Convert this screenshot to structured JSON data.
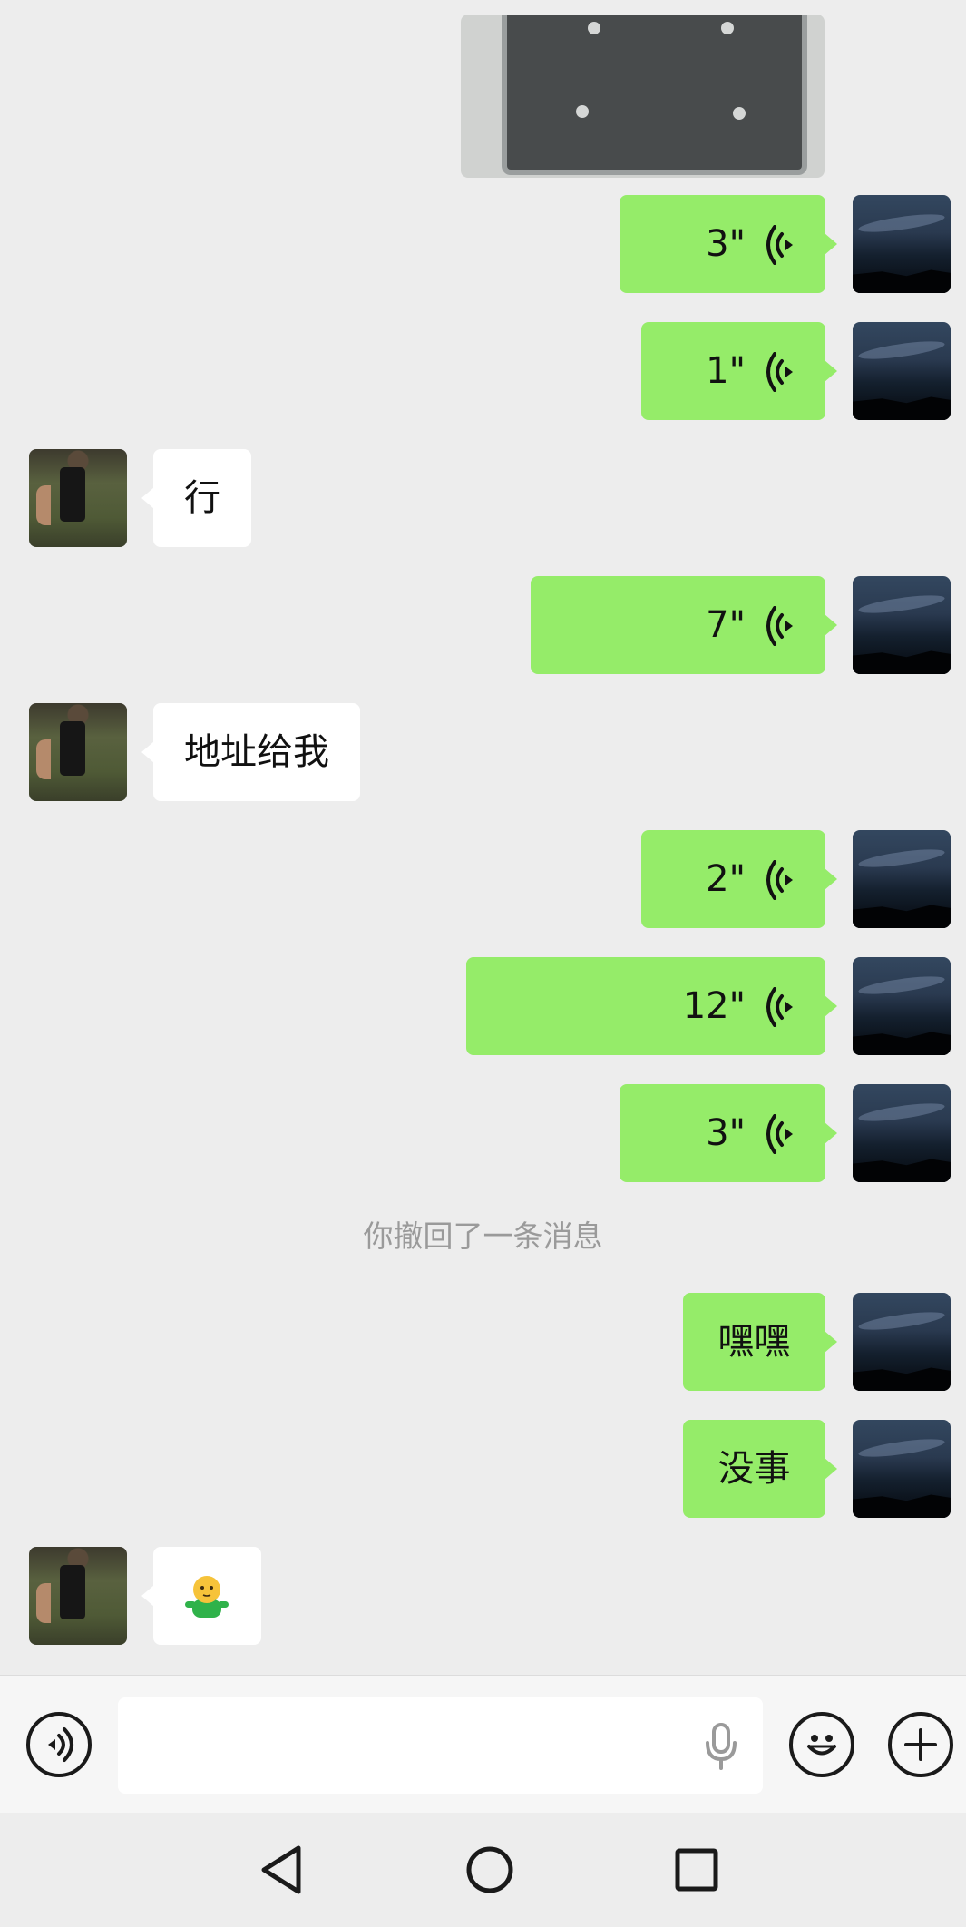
{
  "colors": {
    "background": "#ededed",
    "sent_bubble": "#95ec69",
    "received_bubble": "#ffffff",
    "system_text": "#9a9a9a",
    "input_bar": "#f6f6f6"
  },
  "messages": [
    {
      "type": "image",
      "side": "me"
    },
    {
      "type": "voice",
      "side": "me",
      "duration": "3\""
    },
    {
      "type": "voice",
      "side": "me",
      "duration": "1\""
    },
    {
      "type": "text",
      "side": "them",
      "text": "行"
    },
    {
      "type": "voice",
      "side": "me",
      "duration": "7\""
    },
    {
      "type": "text",
      "side": "them",
      "text": "地址给我"
    },
    {
      "type": "voice",
      "side": "me",
      "duration": "2\""
    },
    {
      "type": "voice",
      "side": "me",
      "duration": "12\""
    },
    {
      "type": "voice",
      "side": "me",
      "duration": "3\""
    },
    {
      "type": "system",
      "text": "你撤回了一条消息"
    },
    {
      "type": "text",
      "side": "me",
      "text": "嘿嘿"
    },
    {
      "type": "text",
      "side": "me",
      "text": "没事"
    },
    {
      "type": "text",
      "side": "them",
      "text": "🫠",
      "icon": "sticker-emoji"
    }
  ],
  "input_bar": {
    "voice_toggle_icon": "voice-mode-icon",
    "text_value": "",
    "mic_icon": "microphone-icon",
    "emoji_icon": "emoji-icon",
    "more_icon": "plus-icon"
  },
  "nav_bar": {
    "back_icon": "back-triangle-icon",
    "home_icon": "home-circle-icon",
    "recents_icon": "recents-square-icon"
  }
}
